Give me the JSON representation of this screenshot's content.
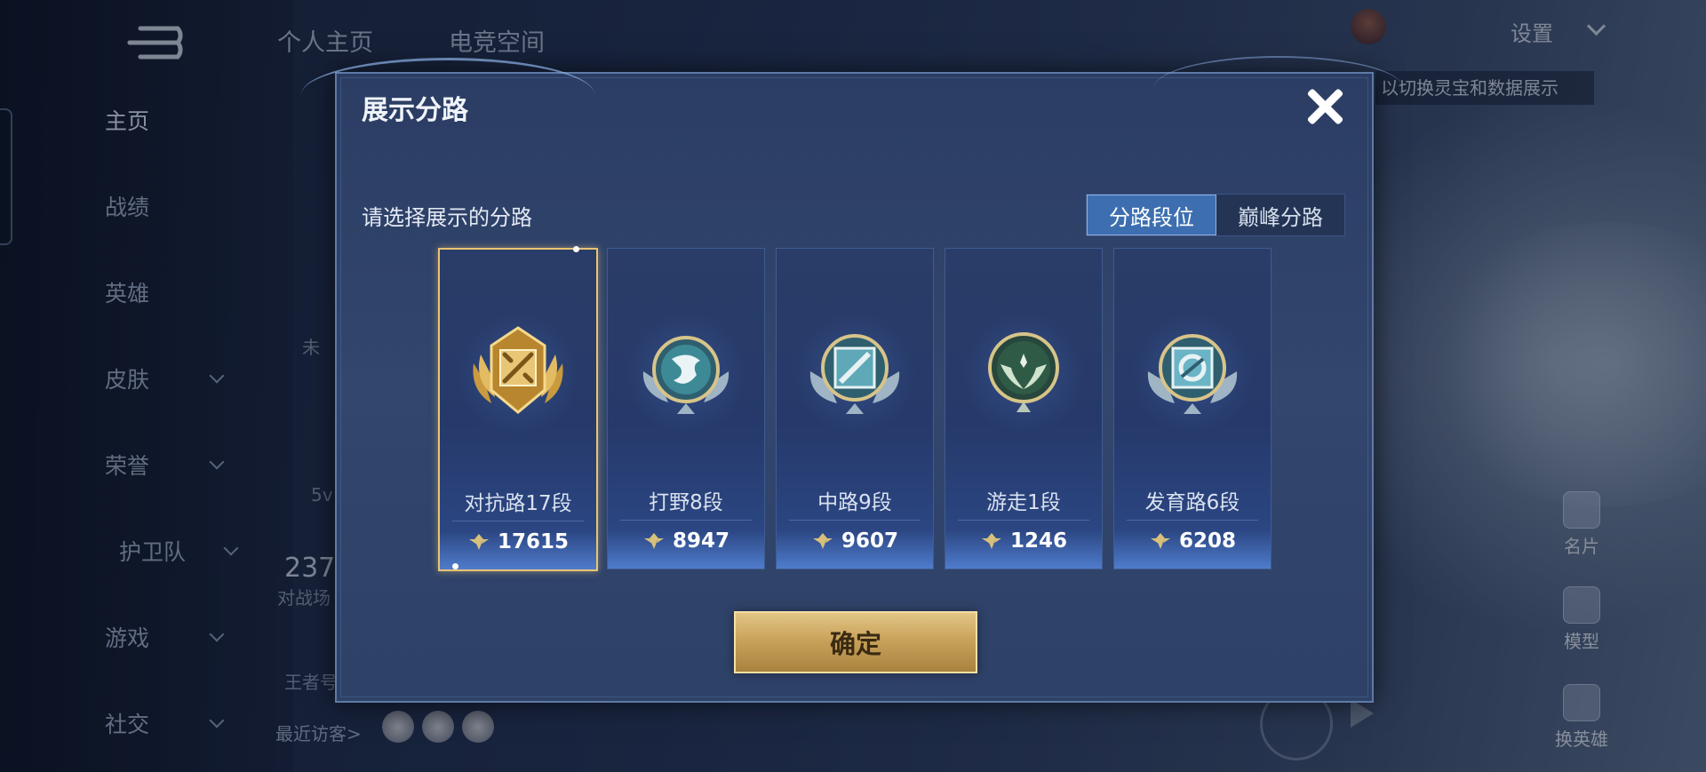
{
  "background": {
    "top_tabs": [
      "个人主页",
      "电竞空间"
    ],
    "settings_label": "设置",
    "hint_text": "以切换灵宝和数据展示",
    "nav_items": [
      {
        "label": "主页",
        "active": true,
        "has_arrow": false
      },
      {
        "label": "战绩",
        "active": false,
        "has_arrow": false
      },
      {
        "label": "英雄",
        "active": false,
        "has_arrow": false
      },
      {
        "label": "皮肤",
        "active": false,
        "has_arrow": true
      },
      {
        "label": "荣誉",
        "active": false,
        "has_arrow": true
      },
      {
        "label": "护卫队",
        "active": false,
        "has_arrow": true
      },
      {
        "label": "游戏",
        "active": false,
        "has_arrow": true
      },
      {
        "label": "社交",
        "active": false,
        "has_arrow": true
      }
    ],
    "fragments": {
      "status_partial": "未",
      "mode_partial": "5v",
      "count_partial": "237",
      "count_label_partial": "对战场",
      "title_partial": "王者号",
      "recent_visitors": "最近访客>"
    },
    "side_buttons": [
      {
        "label": "名片",
        "icon": "card-icon"
      },
      {
        "label": "模型",
        "icon": "model-icon"
      },
      {
        "label": "换英雄",
        "icon": "swap-hero-icon"
      }
    ]
  },
  "dialog": {
    "title": "展示分路",
    "subtitle": "请选择展示的分路",
    "toggle": [
      {
        "label": "分路段位",
        "active": true
      },
      {
        "label": "巅峰分路",
        "active": false
      }
    ],
    "cards": [
      {
        "rank": "对抗路17段",
        "score": "17615",
        "selected": true,
        "emblem": "sword-emblem-icon",
        "tier": "gold"
      },
      {
        "rank": "打野8段",
        "score": "8947",
        "selected": false,
        "emblem": "dragon-emblem-icon",
        "tier": "silver"
      },
      {
        "rank": "中路9段",
        "score": "9607",
        "selected": false,
        "emblem": "staff-emblem-icon",
        "tier": "silver"
      },
      {
        "rank": "游走1段",
        "score": "1246",
        "selected": false,
        "emblem": "wing-emblem-icon",
        "tier": "green"
      },
      {
        "rank": "发育路6段",
        "score": "6208",
        "selected": false,
        "emblem": "bow-emblem-icon",
        "tier": "silver"
      }
    ],
    "confirm_label": "确定",
    "close_icon": "close-icon"
  },
  "colors": {
    "accent_gold": "#e8c474",
    "toggle_active": "#3d6fb0",
    "dialog_bg": "#2f436b"
  }
}
